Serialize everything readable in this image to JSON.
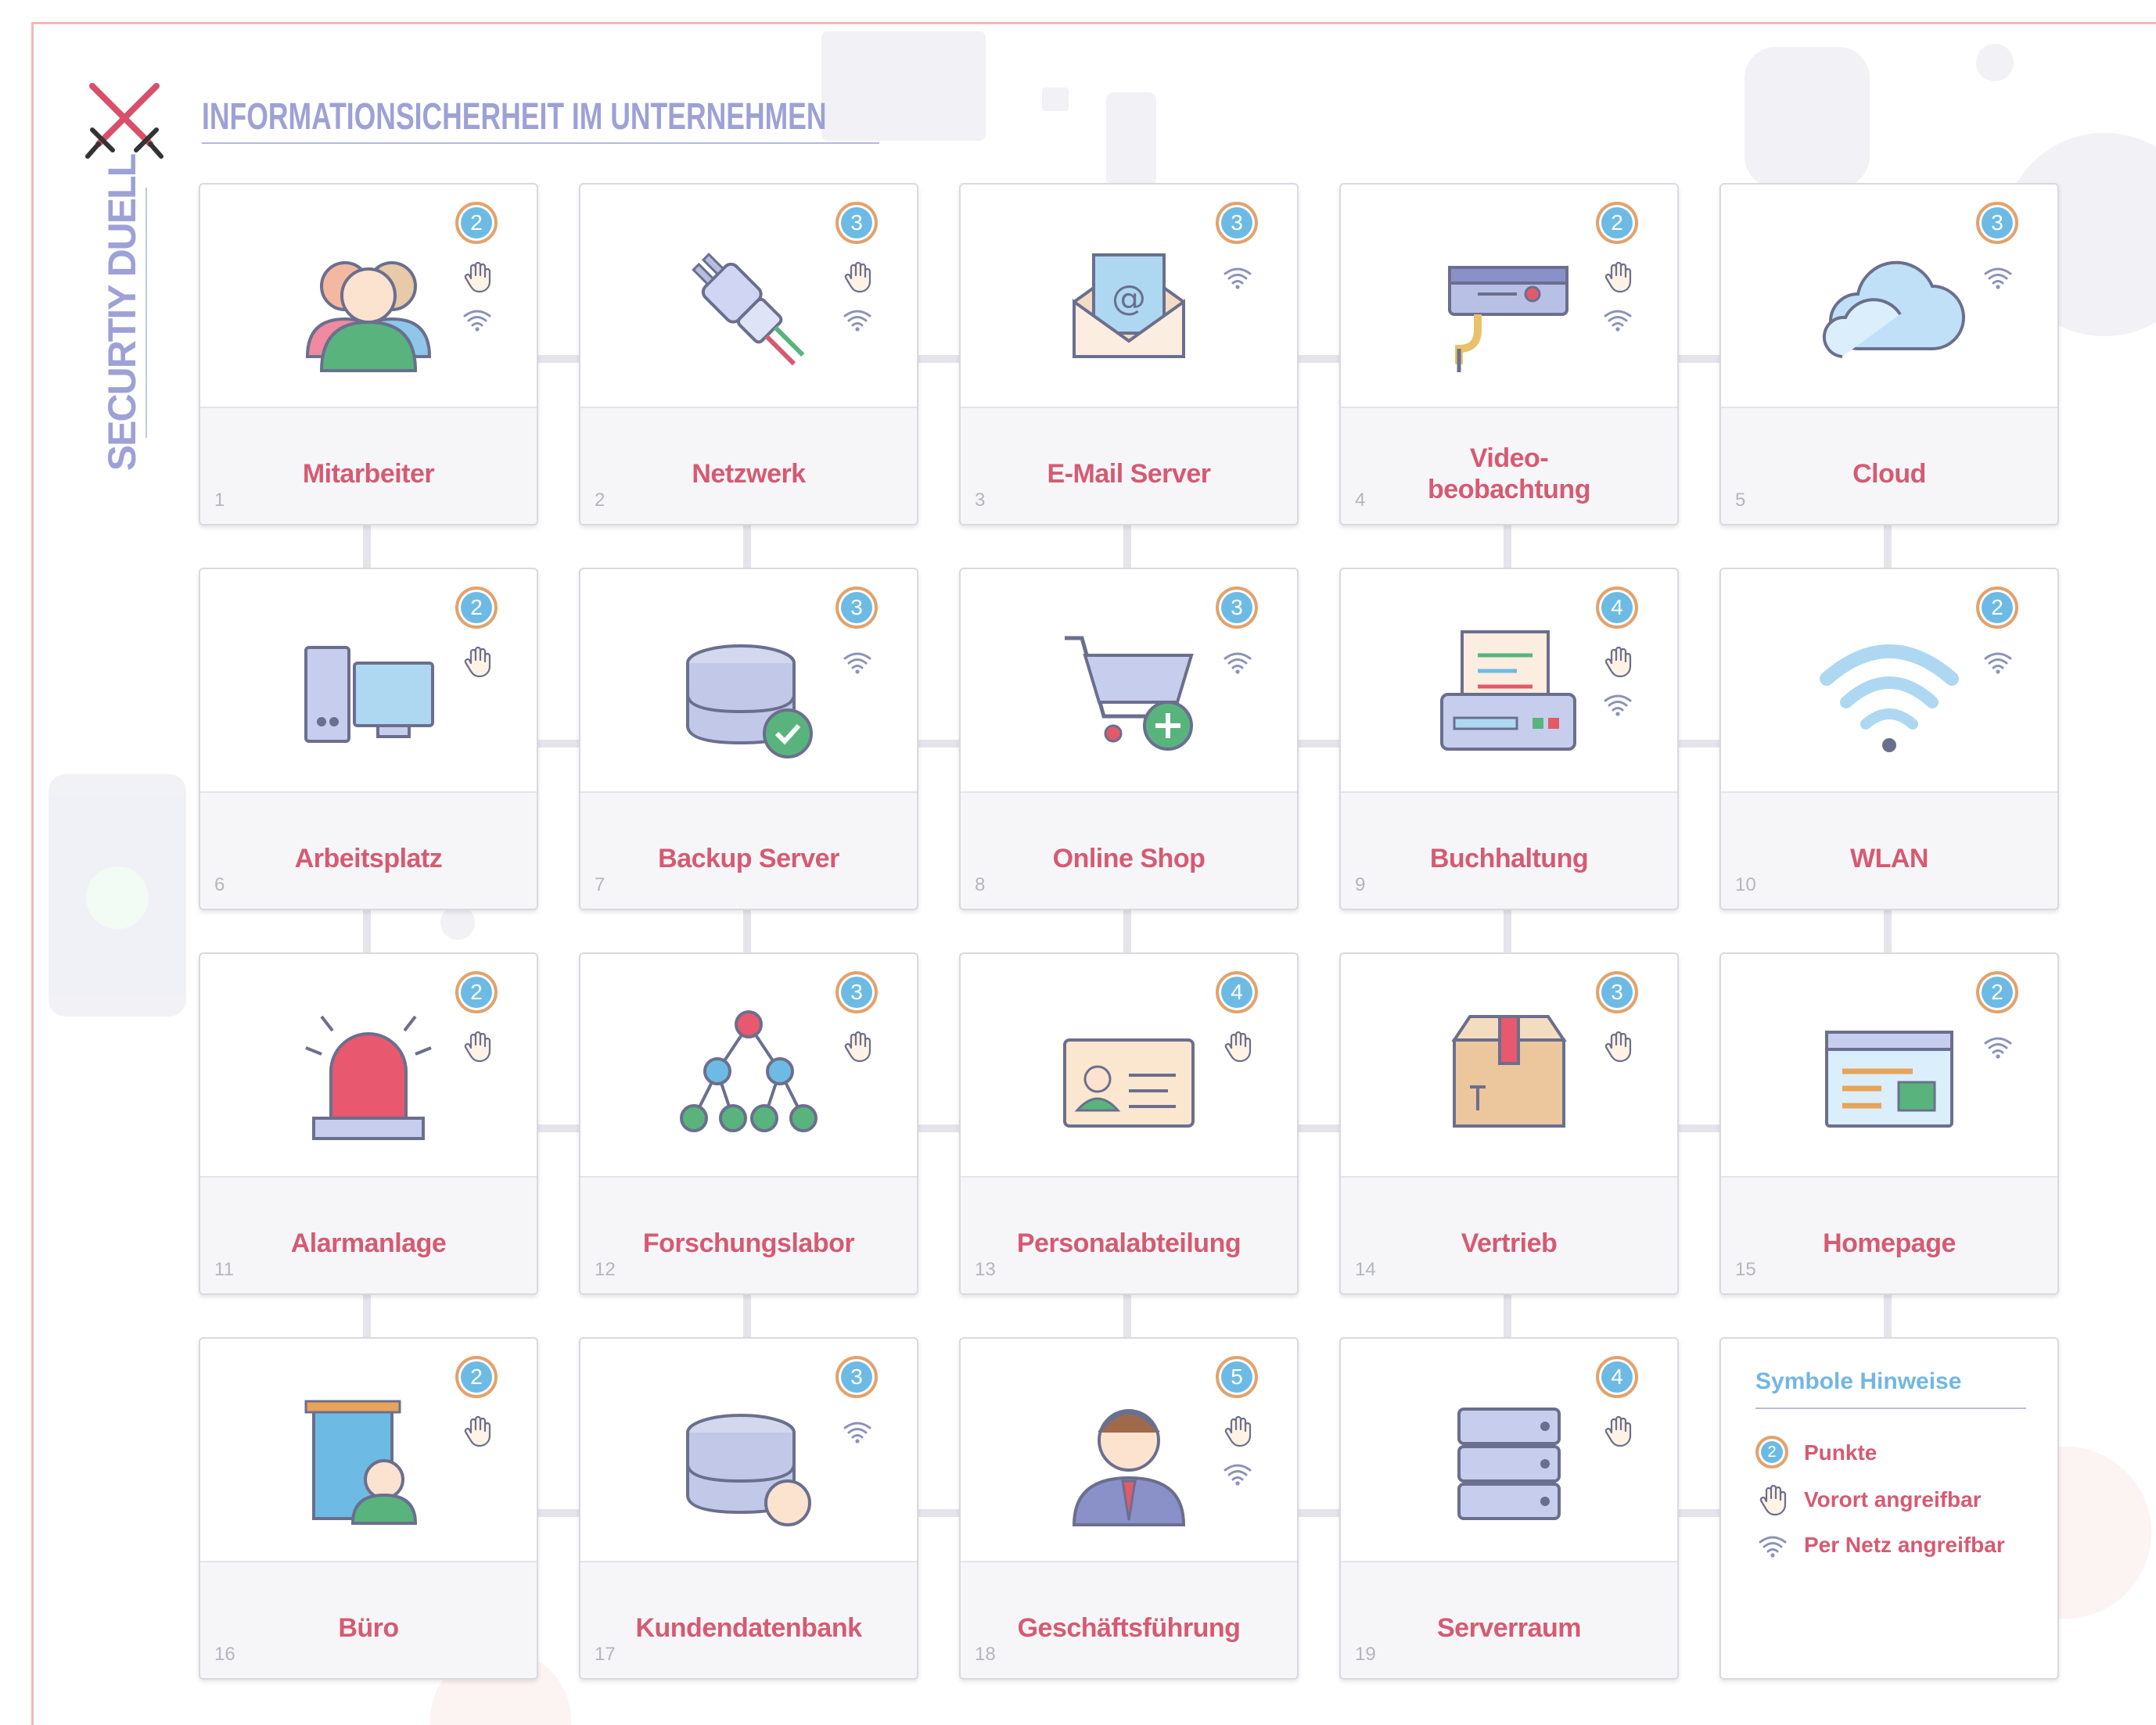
{
  "header": {
    "title": "INFORMATIONSICHERHEIT IM UNTERNEHMEN",
    "brand": "SECURTIY DUELL"
  },
  "cards": [
    {
      "number": "1",
      "name": "Mitarbeiter",
      "points": "2",
      "icon": "people-icon",
      "onsite": true,
      "network": true
    },
    {
      "number": "2",
      "name": "Netzwerk",
      "points": "3",
      "icon": "network-plug-icon",
      "onsite": true,
      "network": true
    },
    {
      "number": "3",
      "name": "E-Mail Server",
      "points": "3",
      "icon": "email-icon",
      "onsite": false,
      "network": true
    },
    {
      "number": "4",
      "name": "Video-\nbeobachtung",
      "points": "2",
      "icon": "security-camera-icon",
      "onsite": true,
      "network": true
    },
    {
      "number": "5",
      "name": "Cloud",
      "points": "3",
      "icon": "cloud-icon",
      "onsite": false,
      "network": true
    },
    {
      "number": "6",
      "name": "Arbeitsplatz",
      "points": "2",
      "icon": "computer-icon",
      "onsite": true,
      "network": false
    },
    {
      "number": "7",
      "name": "Backup Server",
      "points": "3",
      "icon": "database-check-icon",
      "onsite": false,
      "network": true
    },
    {
      "number": "8",
      "name": "Online Shop",
      "points": "3",
      "icon": "shopping-cart-icon",
      "onsite": false,
      "network": true
    },
    {
      "number": "9",
      "name": "Buchhaltung",
      "points": "4",
      "icon": "cash-register-icon",
      "onsite": true,
      "network": true
    },
    {
      "number": "10",
      "name": "WLAN",
      "points": "2",
      "icon": "wifi-icon",
      "onsite": false,
      "network": true
    },
    {
      "number": "11",
      "name": "Alarmanlage",
      "points": "2",
      "icon": "alarm-siren-icon",
      "onsite": true,
      "network": false
    },
    {
      "number": "12",
      "name": "Forschungslabor",
      "points": "3",
      "icon": "hierarchy-icon",
      "onsite": true,
      "network": false
    },
    {
      "number": "13",
      "name": "Personalabteilung",
      "points": "4",
      "icon": "id-card-icon",
      "onsite": true,
      "network": false
    },
    {
      "number": "14",
      "name": "Vertrieb",
      "points": "3",
      "icon": "package-box-icon",
      "onsite": true,
      "network": false
    },
    {
      "number": "15",
      "name": "Homepage",
      "points": "2",
      "icon": "web-page-icon",
      "onsite": false,
      "network": true
    },
    {
      "number": "16",
      "name": "Büro",
      "points": "2",
      "icon": "office-building-icon",
      "onsite": true,
      "network": false
    },
    {
      "number": "17",
      "name": "Kundendatenbank",
      "points": "3",
      "icon": "database-customer-icon",
      "onsite": false,
      "network": true
    },
    {
      "number": "18",
      "name": "Geschäftsführung",
      "points": "5",
      "icon": "manager-icon",
      "onsite": true,
      "network": true
    },
    {
      "number": "19",
      "name": "Serverraum",
      "points": "4",
      "icon": "server-rack-icon",
      "onsite": true,
      "network": false
    }
  ],
  "legend": {
    "title": "Symbole Hinweise",
    "badge_example": "2",
    "items": [
      {
        "label": "Punkte",
        "icon": "points-badge-icon"
      },
      {
        "label": "Vorort angreifbar",
        "icon": "hand-icon"
      },
      {
        "label": "Per Netz angreifbar",
        "icon": "wifi-signal-icon"
      }
    ]
  },
  "colors": {
    "accent_title": "#9ea1d6",
    "card_label": "#d65a72",
    "legend_title": "#72b6e4",
    "badge_fill": "#6dbbe4",
    "badge_ring": "#e4a26a"
  }
}
